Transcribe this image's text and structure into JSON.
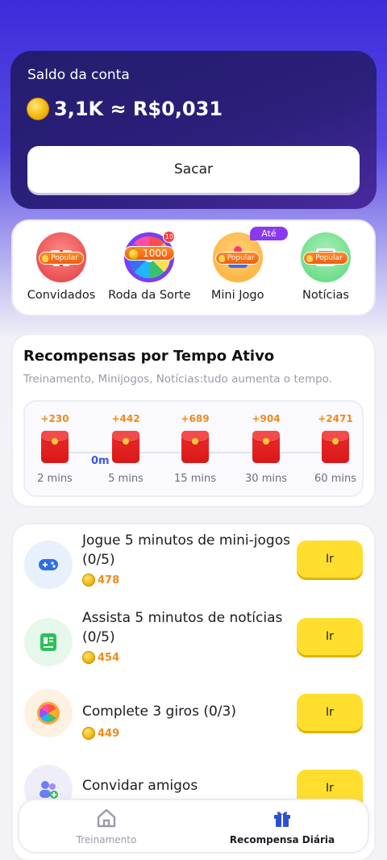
{
  "balance": {
    "label": "Saldo da conta",
    "amount": "3,1K ≈ R$0,031",
    "withdraw_label": "Sacar"
  },
  "features": [
    {
      "label": "Convidados",
      "badge": "Popular",
      "icon": "gift-icon"
    },
    {
      "label": "Roda da Sorte",
      "badge": "1000",
      "notification": "10",
      "icon": "wheel-icon"
    },
    {
      "label": "Mini Jogo",
      "badge": "Popular",
      "top_badge": "Até",
      "icon": "joystick-icon"
    },
    {
      "label": "Notícias",
      "badge": "Popular",
      "icon": "newspaper-icon"
    }
  ],
  "active_rewards": {
    "title": "Recompensas por Tempo Ativo",
    "subtitle": "Treinamento, Minijogos, Notícias:tudo aumenta o tempo.",
    "progress": "0m",
    "milestones": [
      {
        "reward": "+230",
        "time": "2 mins"
      },
      {
        "reward": "+442",
        "time": "5 mins"
      },
      {
        "reward": "+689",
        "time": "15 mins"
      },
      {
        "reward": "+904",
        "time": "30 mins"
      },
      {
        "reward": "+2471",
        "time": "60 mins"
      }
    ]
  },
  "tasks": [
    {
      "title": "Jogue 5 minutos de mini-jogos (0/5)",
      "reward": "478",
      "button": "Ir",
      "icon": "gamepad-icon"
    },
    {
      "title": "Assista 5 minutos de notícias (0/5)",
      "reward": "454",
      "button": "Ir",
      "icon": "news-icon"
    },
    {
      "title": "Complete 3 giros (0/3)",
      "reward": "449",
      "button": "Ir",
      "icon": "wheel-icon"
    },
    {
      "title": "Convidar amigos",
      "reward": "",
      "button": "Ir",
      "icon": "invite-friends-icon"
    }
  ],
  "nav": {
    "training": "Treinamento",
    "daily_reward": "Recompensa Diária"
  },
  "colors": {
    "accent": "#3a2be0",
    "button_yellow": "#ffde2e",
    "reward_orange": "#f08a1a"
  }
}
